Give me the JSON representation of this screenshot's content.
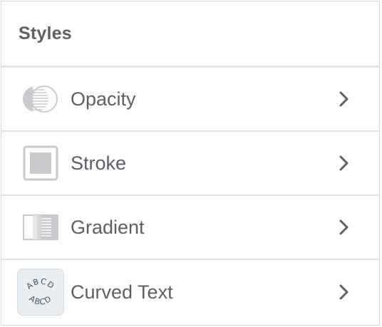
{
  "panel": {
    "title": "Styles",
    "items": [
      {
        "label": "Opacity",
        "icon": "opacity-icon"
      },
      {
        "label": "Stroke",
        "icon": "stroke-icon"
      },
      {
        "label": "Gradient",
        "icon": "gradient-icon"
      },
      {
        "label": "Curved Text",
        "icon": "curved-text-icon",
        "icon_text_top": "ABCD",
        "icon_text_bottom": "ABCD"
      }
    ]
  },
  "colors": {
    "text": "#5b6066",
    "icon_gray": "#c4c6c9",
    "divider": "#e3e3e3",
    "curved_icon_bg": "#e8eef1",
    "curved_icon_text": "#3e5566"
  }
}
